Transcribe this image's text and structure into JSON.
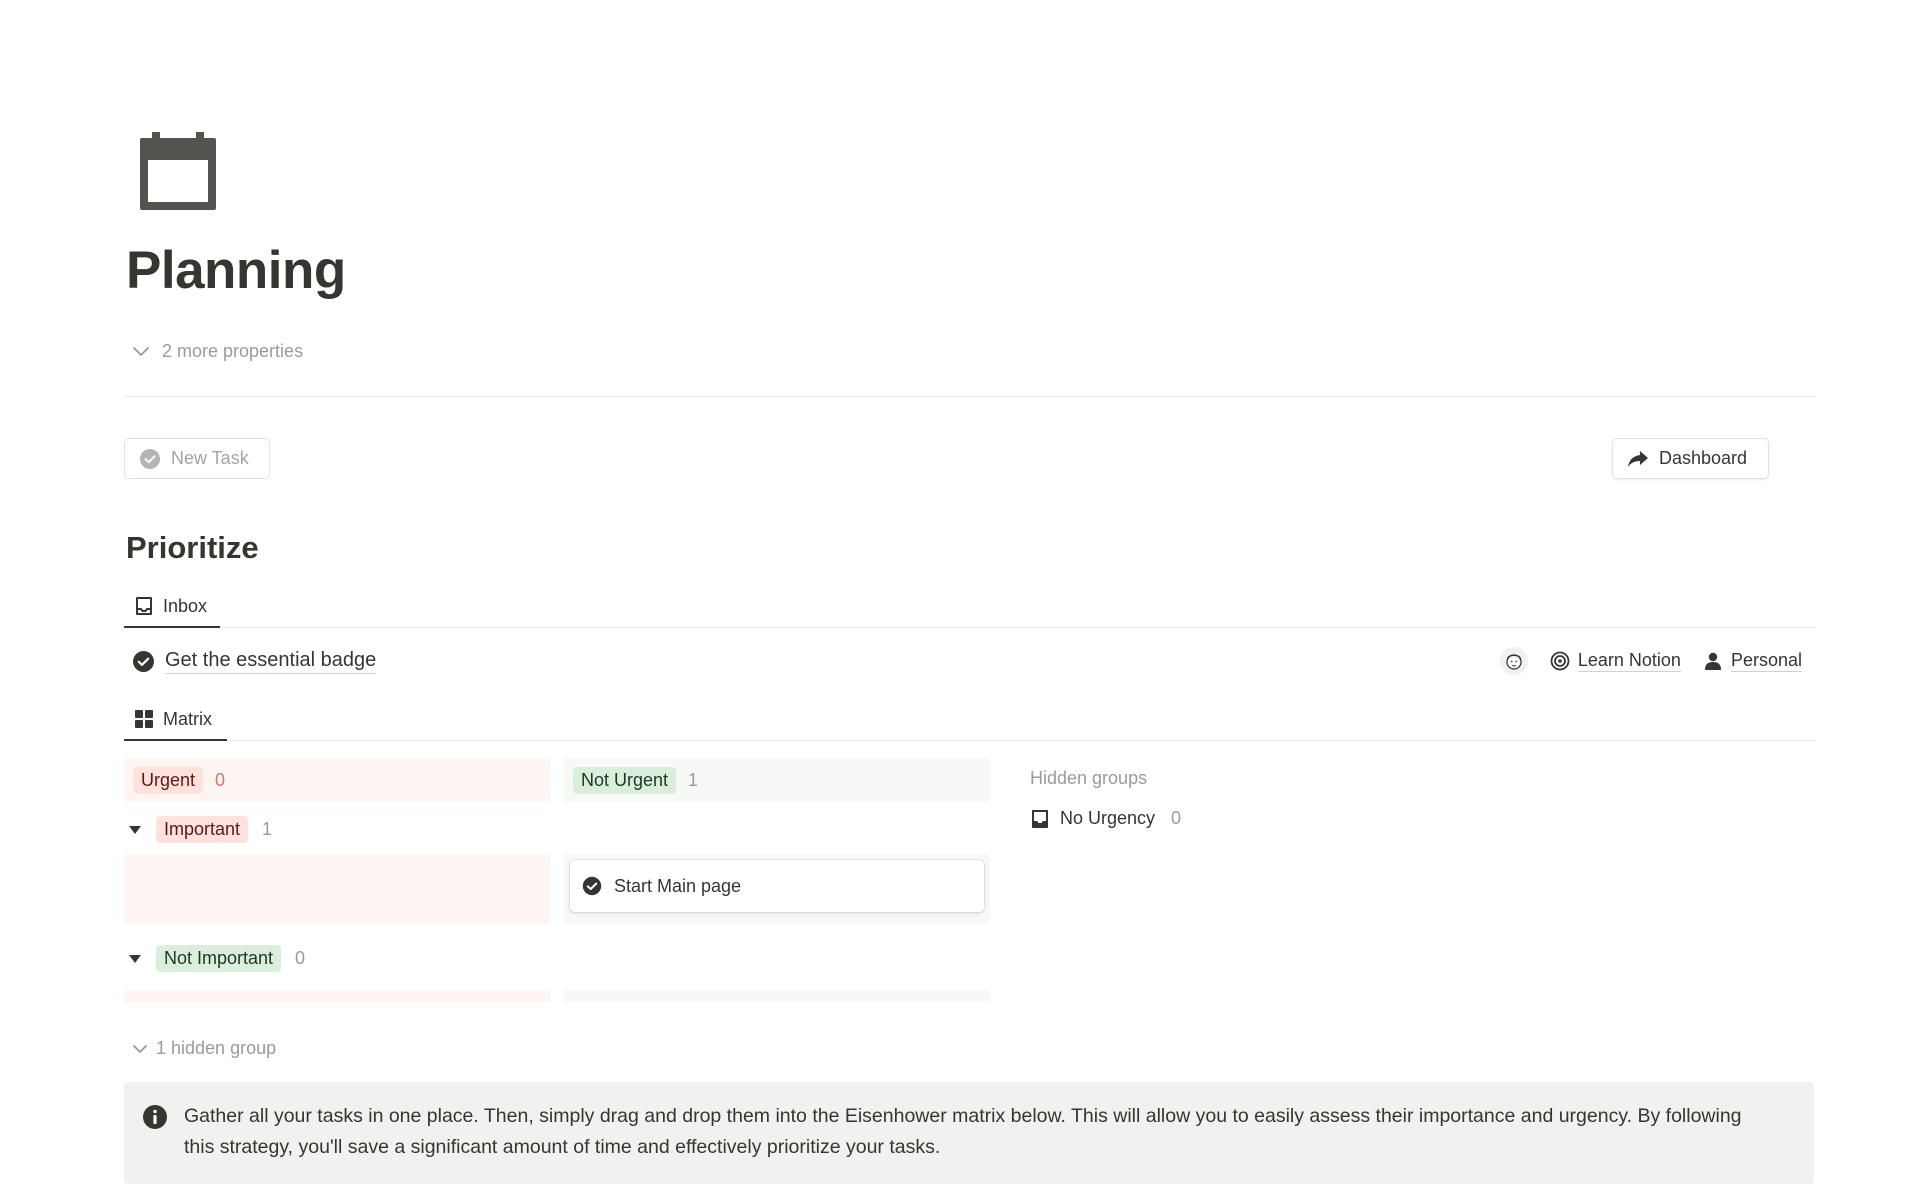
{
  "page": {
    "icon": "calendar-icon",
    "title": "Planning",
    "more_properties": "2 more properties"
  },
  "buttons": {
    "new_task": "New Task",
    "dashboard": "Dashboard"
  },
  "section": {
    "title": "Prioritize"
  },
  "tabs": {
    "inbox": "Inbox",
    "matrix": "Matrix"
  },
  "inbox": {
    "task_title": "Get the essential badge",
    "project": "Learn Notion",
    "area": "Personal"
  },
  "matrix": {
    "columns": [
      {
        "label": "Urgent",
        "count": "0",
        "color": "#ffe2dd"
      },
      {
        "label": "Not Urgent",
        "count": "1",
        "color": "#dbeddb"
      }
    ],
    "rows": [
      {
        "label": "Important",
        "count": "1"
      },
      {
        "label": "Not Important",
        "count": "0"
      }
    ],
    "card": {
      "title": "Start Main page"
    },
    "hidden_groups_label": "Hidden groups",
    "hidden_groups": [
      {
        "label": "No Urgency",
        "count": "0"
      }
    ],
    "hidden_group_toggle": "1 hidden group"
  },
  "callout": {
    "icon": "info-icon",
    "text": "Gather all your tasks in one place. Then, simply drag and drop them into the Eisenhower matrix below. This will allow you to easily assess their importance and urgency. By following this strategy, you'll save a significant amount of time and effectively prioritize your tasks."
  }
}
